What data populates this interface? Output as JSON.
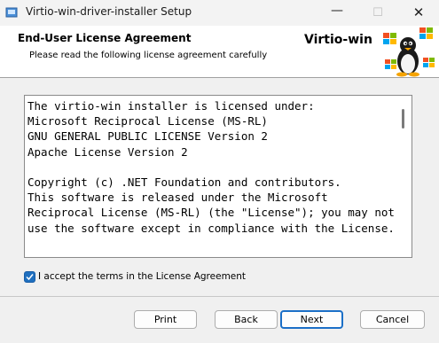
{
  "window": {
    "title": "Virtio-win-driver-installer Setup",
    "minimize_glyph": "—",
    "maximize_glyph": "☐",
    "close_glyph": "✕"
  },
  "banner": {
    "title": "End-User License Agreement",
    "subtitle": "Please read the following license agreement carefully",
    "brand": "Virtio-win"
  },
  "license": {
    "text": "The virtio-win installer is licensed under:\nMicrosoft Reciprocal License (MS-RL)\nGNU GENERAL PUBLIC LICENSE Version 2\nApache License Version 2\n\nCopyright (c) .NET Foundation and contributors.\nThis software is released under the Microsoft Reciprocal License (MS-RL) (the \"License\"); you may not use the software except in compliance with the License."
  },
  "accept": {
    "label": "I accept the terms in the License Agreement",
    "checked": true
  },
  "buttons": {
    "print": "Print",
    "back": "Back",
    "next": "Next",
    "cancel": "Cancel"
  },
  "colors": {
    "accent": "#1b6fc7",
    "checkbox": "#1f6fbf"
  }
}
